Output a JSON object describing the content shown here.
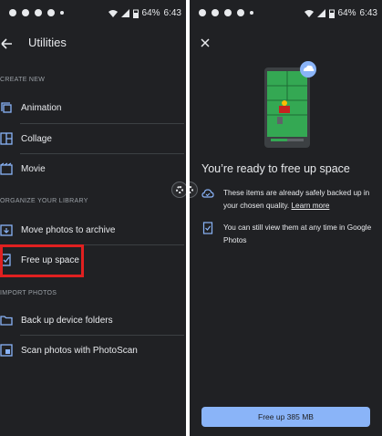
{
  "status_bar": {
    "battery": "64%",
    "time": "6:43"
  },
  "left": {
    "title": "Utilities",
    "sections": [
      {
        "label": "CREATE NEW",
        "items": [
          {
            "label": "Animation",
            "icon": "animation-icon"
          },
          {
            "label": "Collage",
            "icon": "collage-icon"
          },
          {
            "label": "Movie",
            "icon": "movie-icon"
          }
        ]
      },
      {
        "label": "ORGANIZE YOUR LIBRARY",
        "items": [
          {
            "label": "Move photos to archive",
            "icon": "archive-icon"
          },
          {
            "label": "Free up space",
            "icon": "free-up-space-icon",
            "highlighted": true
          }
        ]
      },
      {
        "label": "IMPORT PHOTOS",
        "items": [
          {
            "label": "Back up device folders",
            "icon": "folder-icon"
          },
          {
            "label": "Scan photos with PhotoScan",
            "icon": "photoscan-icon"
          }
        ]
      }
    ]
  },
  "right": {
    "title": "You’re ready to free up space",
    "rows": [
      {
        "icon": "cloud-done-icon",
        "text": "These items are already safely backed up in your chosen quality. ",
        "link": "Learn more"
      },
      {
        "icon": "phone-check-icon",
        "text": "You can still view them at any time in Google Photos"
      }
    ],
    "button": "Free up 385 MB"
  },
  "colors": {
    "background": "#202124",
    "accent": "#8ab4f8",
    "highlight": "#e02020",
    "text": "#e8eaed",
    "muted": "#9aa0a6"
  }
}
